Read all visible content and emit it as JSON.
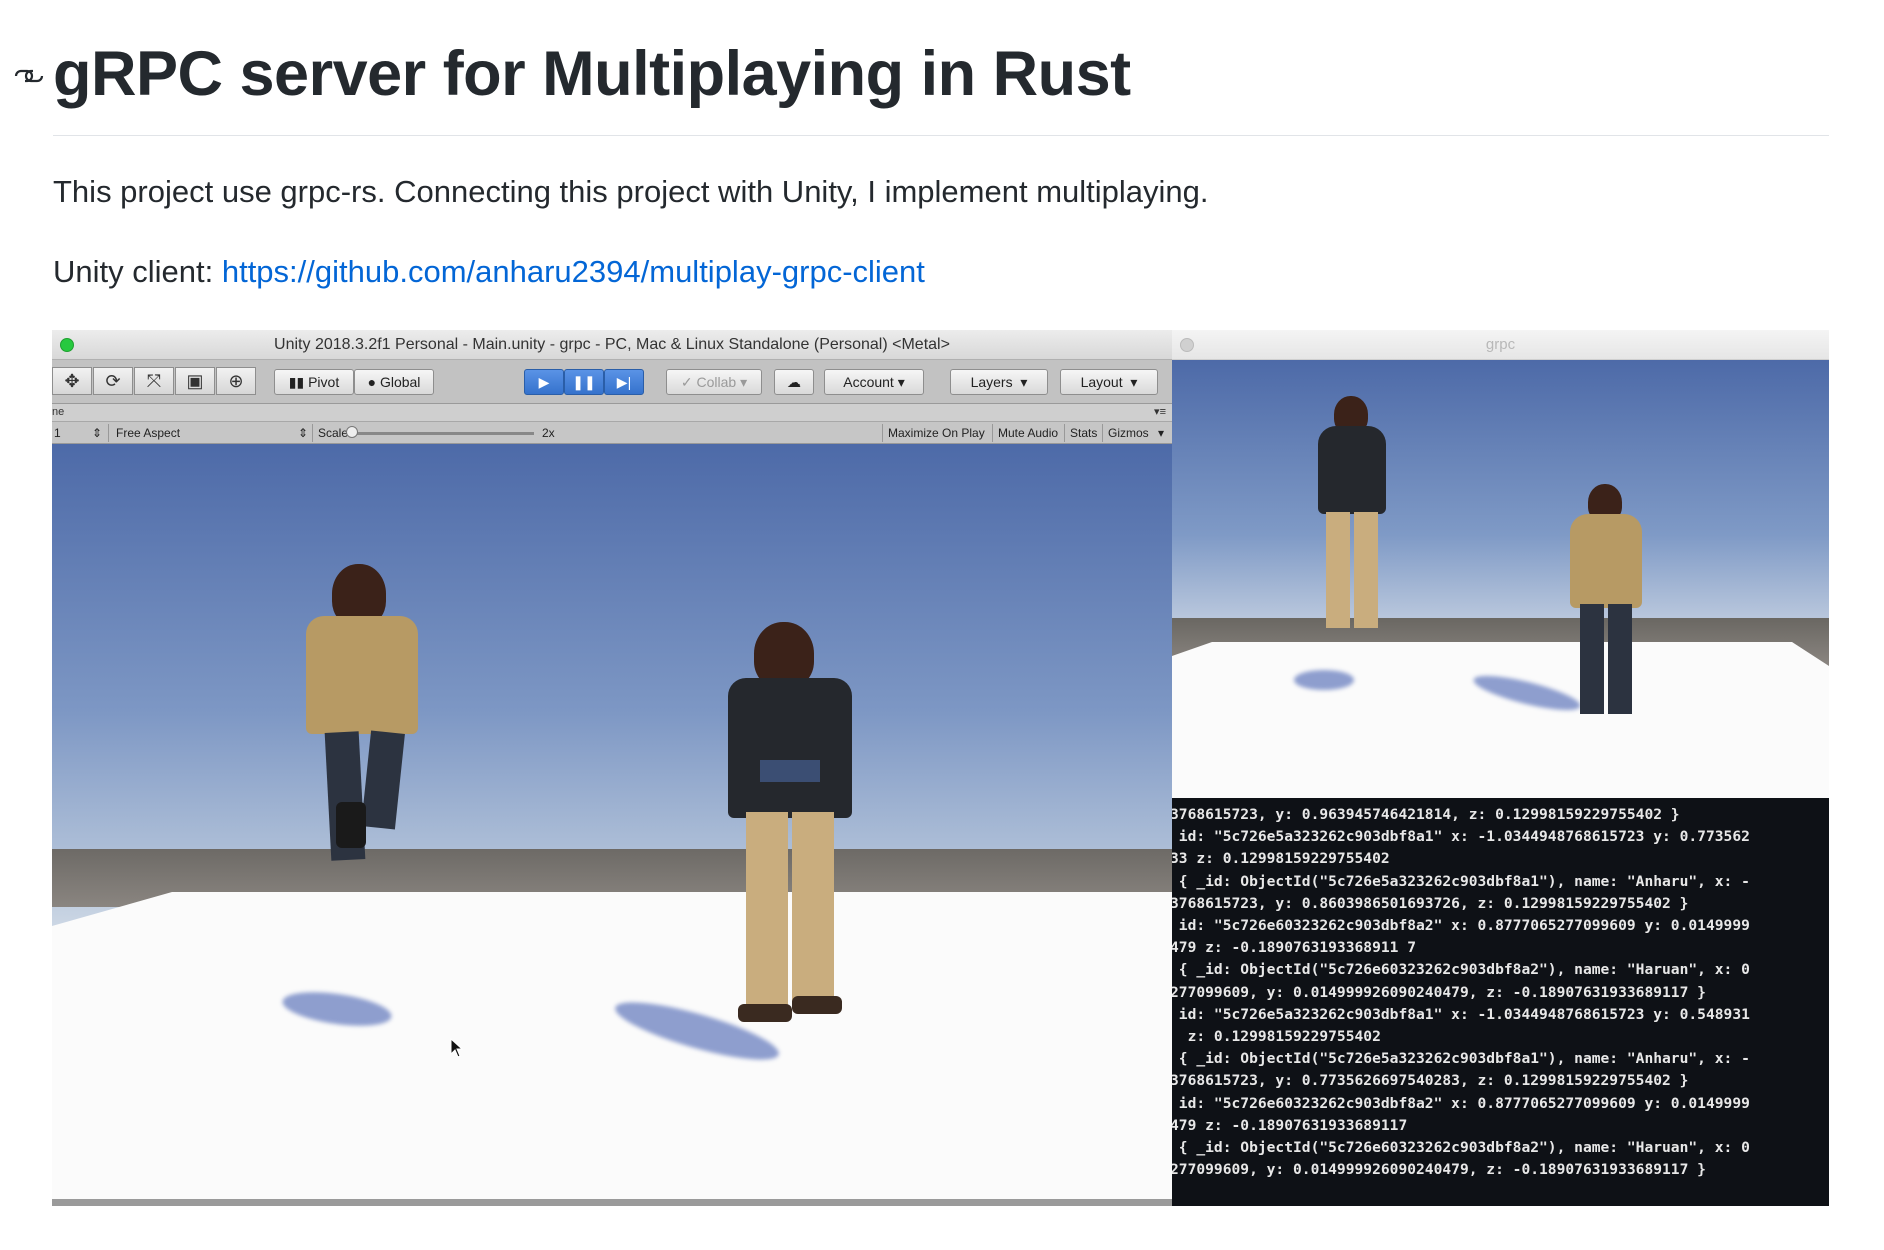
{
  "heading": {
    "title": "gRPC server for Multiplaying in Rust",
    "anchor_icon": "link-icon"
  },
  "intro": "This project use grpc-rs. Connecting this project with Unity, I implement multiplaying.",
  "client": {
    "label": "Unity client: ",
    "url": "https://github.com/anharu2394/multiplay-grpc-client"
  },
  "unity_window": {
    "title": "Unity 2018.3.2f1 Personal - Main.unity - grpc - PC, Mac & Linux Standalone (Personal) <Metal>",
    "toolbar": {
      "pivot": "Pivot",
      "global": "Global",
      "collab": "Collab",
      "account": "Account",
      "layers": "Layers",
      "layout": "Layout"
    },
    "tab_fragment": "ne",
    "game_bar": {
      "display": "1",
      "aspect": "Free Aspect",
      "scale_label": "Scale",
      "scale_value": "2x",
      "maximize": "Maximize On Play",
      "mute": "Mute Audio",
      "stats": "Stats",
      "gizmos": "Gizmos"
    }
  },
  "grpc_window": {
    "title": "grpc",
    "log_lines": [
      "3768615723, y: 0.963945746421814, z: 0.12998159229755402 }",
      " id: \"5c726e5a323262c903dbf8a1\" x: -1.0344948768615723 y: 0.773562",
      "33 z: 0.12998159229755402",
      " { _id: ObjectId(\"5c726e5a323262c903dbf8a1\"), name: \"Anharu\", x: -",
      "3768615723, y: 0.8603986501693726, z: 0.12998159229755402 }",
      " id: \"5c726e60323262c903dbf8a2\" x: 0.8777065277099609 y: 0.0149999",
      "479 z: -0.1890763193368911 7",
      " { _id: ObjectId(\"5c726e60323262c903dbf8a2\"), name: \"Haruan\", x: 0",
      "277099609, y: 0.014999926090240479, z: -0.18907631933689117 }",
      " id: \"5c726e5a323262c903dbf8a1\" x: -1.0344948768615723 y: 0.548931",
      "  z: 0.12998159229755402",
      " { _id: ObjectId(\"5c726e5a323262c903dbf8a1\"), name: \"Anharu\", x: -",
      "3768615723, y: 0.7735626697540283, z: 0.12998159229755402 }",
      " id: \"5c726e60323262c903dbf8a2\" x: 0.8777065277099609 y: 0.0149999",
      "479 z: -0.18907631933689117",
      " { _id: ObjectId(\"5c726e60323262c903dbf8a2\"), name: \"Haruan\", x: 0",
      "277099609, y: 0.014999926090240479, z: -0.18907631933689117 }"
    ]
  },
  "colors": {
    "link": "#0366d6",
    "text": "#24292e",
    "terminal_bg": "#0e1116",
    "play_button": "#3572cc"
  }
}
